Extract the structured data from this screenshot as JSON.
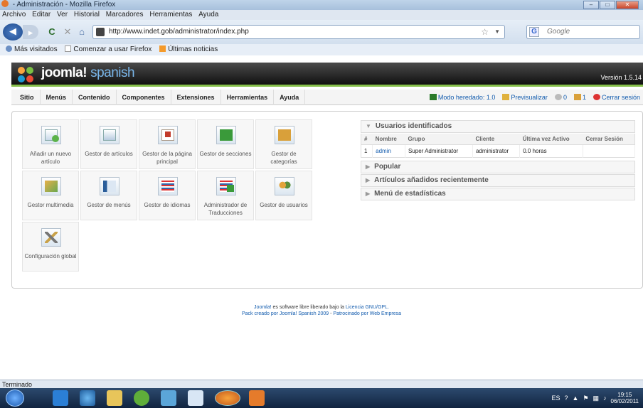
{
  "browser": {
    "window_title": "- Administración - Mozilla Firefox",
    "menu": [
      "Archivo",
      "Editar",
      "Ver",
      "Historial",
      "Marcadores",
      "Herramientas",
      "Ayuda"
    ],
    "url": "http://www.indet.gob/administrator/index.php",
    "search_placeholder": "Google",
    "bookmarks": [
      "Más visitados",
      "Comenzar a usar Firefox",
      "Últimas noticias"
    ],
    "status": "Terminado"
  },
  "joomla": {
    "brand": "joomla!",
    "brand_lang": "spanish",
    "version": "Versión 1.5.14",
    "menu": [
      "Sitio",
      "Menús",
      "Contenido",
      "Componentes",
      "Extensiones",
      "Herramientas",
      "Ayuda"
    ],
    "status": {
      "mode": "Modo heredado: 1.0",
      "preview": "Previsualizar",
      "messages": "0",
      "users": "1",
      "logout": "Cerrar sesión"
    },
    "quickicons": [
      {
        "label": "Añadir un nuevo artículo",
        "icon": "new-article-icon"
      },
      {
        "label": "Gestor de artículos",
        "icon": "article-manager-icon"
      },
      {
        "label": "Gestor de la página principal",
        "icon": "frontpage-manager-icon"
      },
      {
        "label": "Gestor de secciones",
        "icon": "section-manager-icon"
      },
      {
        "label": "Gestor de categorías",
        "icon": "category-manager-icon"
      },
      {
        "label": "Gestor multimedia",
        "icon": "media-manager-icon"
      },
      {
        "label": "Gestor de menús",
        "icon": "menu-manager-icon"
      },
      {
        "label": "Gestor de idiomas",
        "icon": "language-manager-icon"
      },
      {
        "label": "Administrador de Traducciones",
        "icon": "translation-manager-icon"
      },
      {
        "label": "Gestor de usuarios",
        "icon": "user-manager-icon"
      },
      {
        "label": "Configuración global",
        "icon": "global-config-icon"
      }
    ],
    "modules": {
      "users_title": "Usuarios identificados",
      "columns": [
        "#",
        "Nombre",
        "Grupo",
        "Cliente",
        "Última vez Activo",
        "Cerrar Sesión"
      ],
      "rows": [
        {
          "num": "1",
          "name": "admin",
          "group": "Super Administrator",
          "client": "administrator",
          "last_active": "0.0 horas",
          "logout": ""
        }
      ],
      "collapsed": [
        "Popular",
        "Artículos añadidos recientemente",
        "Menú de estadísticas"
      ]
    },
    "footer": {
      "line1_link": "Joomla!",
      "line1_text": " es software libre liberado bajo la ",
      "line1_license": "Licencia GNU/GPL.",
      "line2_link": "Pack creado por Joomla! Spanish 2009",
      "line2_sep": " - ",
      "line2_link2": "Patrocinado por Web Empresa"
    }
  },
  "taskbar": {
    "lang": "ES",
    "time": "19:15",
    "date": "06/02/2011"
  },
  "colors": {
    "joomla_green": "#86c04a",
    "link_blue": "#135cae",
    "header_dark": "#111111"
  }
}
